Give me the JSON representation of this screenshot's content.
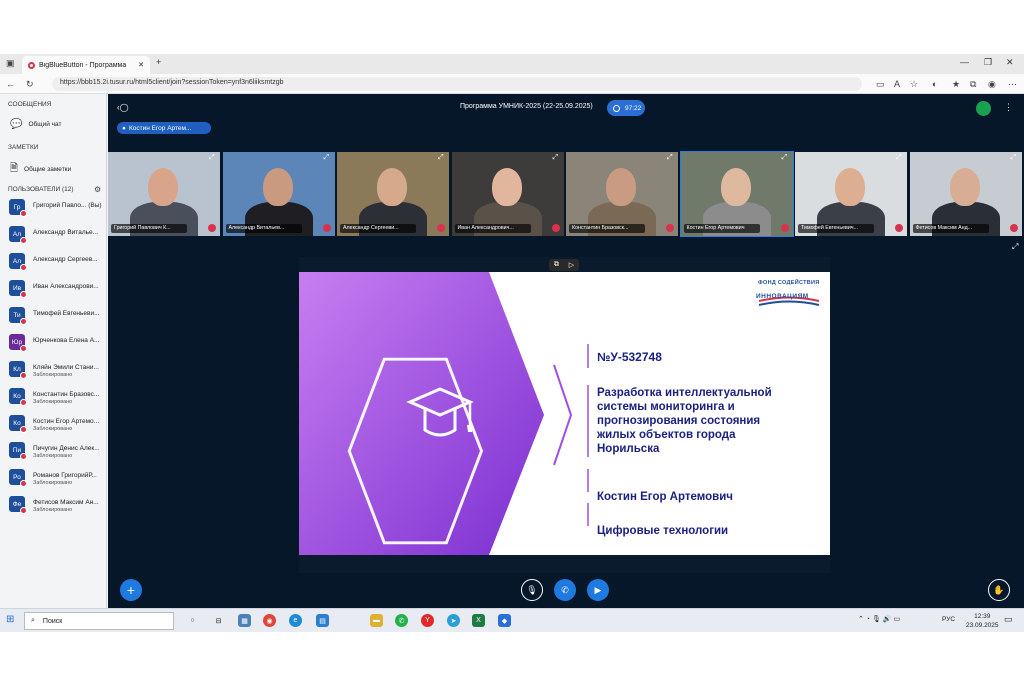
{
  "browser": {
    "tab_title": "BigBlueButton - Программа",
    "url": "https://bbb15.2i.tusur.ru/html5client/join?sessionToken=ynf3n6liiksmtzgb"
  },
  "sidebar": {
    "messages_title": "СООБЩЕНИЯ",
    "public_chat": "Общий чат",
    "notes_title": "ЗАМЕТКИ",
    "shared_notes": "Общие заметки",
    "users_title": "ПОЛЬЗОВАТЕЛИ (12)",
    "users": [
      {
        "initials": "Гр",
        "name": "Григорий Павло... (Вы)",
        "status": "",
        "color": "#1f4f9a"
      },
      {
        "initials": "Ал",
        "name": "Александр Виталье...",
        "status": "",
        "color": "#1f4f9a"
      },
      {
        "initials": "Ал",
        "name": "Александр Сергеев...",
        "status": "",
        "color": "#1f4f9a"
      },
      {
        "initials": "Ив",
        "name": "Иван Александрови...",
        "status": "",
        "color": "#1f4f9a"
      },
      {
        "initials": "Ти",
        "name": "Тимофей Евгеньеви...",
        "status": "",
        "color": "#1f4f9a"
      },
      {
        "initials": "Юр",
        "name": "Юрченкова Елена А...",
        "status": "",
        "color": "#6a2a9a"
      },
      {
        "initials": "Кл",
        "name": "Кляйн Эмили Стани...",
        "status": "Заблокировано",
        "color": "#1f4f9a"
      },
      {
        "initials": "Ко",
        "name": "Константин Бразовс...",
        "status": "Заблокировано",
        "color": "#1f4f9a"
      },
      {
        "initials": "Ко",
        "name": "Костин Егор Артемо...",
        "status": "Заблокировано",
        "color": "#1f4f9a"
      },
      {
        "initials": "Пи",
        "name": "Пичугин Денис Алек...",
        "status": "Заблокировано",
        "color": "#1f4f9a"
      },
      {
        "initials": "Ро",
        "name": "Романов ГригорийР...",
        "status": "Заблокировано",
        "color": "#1f4f9a"
      },
      {
        "initials": "Фе",
        "name": "Фетисов Максим Ан...",
        "status": "Заблокировано",
        "color": "#1f4f9a"
      }
    ]
  },
  "meeting": {
    "title": "Программа УМНИК-2025 (22-25.09.2025)",
    "timer": "97:22",
    "presenter": "Костин Егор Артем..."
  },
  "videos": [
    {
      "name": "Григорий Павлович К...",
      "bg": "#b9c3cf",
      "skin": "#d9a58a",
      "shirt": "#4a4f5c"
    },
    {
      "name": "Александр Витальев...",
      "bg": "#5d86b8",
      "skin": "#c99a80",
      "shirt": "#1f1f23"
    },
    {
      "name": "Александр Сергееви...",
      "bg": "#8b7a5a",
      "skin": "#d6a98c",
      "shirt": "#2d2f36"
    },
    {
      "name": "Иван Александрович...",
      "bg": "#3e3c3a",
      "skin": "#e0b79d",
      "shirt": "#5a5248"
    },
    {
      "name": "Константин Бразовск...",
      "bg": "#8a8479",
      "skin": "#c89b82",
      "shirt": "#7a6a55"
    },
    {
      "name": "Костин Егор Артемович",
      "bg": "#6f7a6a",
      "skin": "#dfb8a0",
      "shirt": "#8c8c8c"
    },
    {
      "name": "Тимофей Евгеньевич...",
      "bg": "#d9dde0",
      "skin": "#dcae92",
      "shirt": "#3a3f48"
    },
    {
      "name": "Фетисов Максим Анд...",
      "bg": "#c7ccd2",
      "skin": "#d7ad95",
      "shirt": "#2a2e36"
    }
  ],
  "slide": {
    "logo_line1": "ФОНД СОДЕЙСТВИЯ",
    "logo_line2": "ИННОВАЦИЯМ",
    "number": "№У-532748",
    "project_line1": "Разработка интеллектуальной",
    "project_line2": "системы мониторинга и",
    "project_line3": "прогнозирования состояния",
    "project_line4": "жилых объектов города",
    "project_line5": "Норильска",
    "author": "Костин Егор Артемович",
    "category": "Цифровые технологии",
    "accent": "#a24ee0"
  },
  "taskbar": {
    "search": "Поиск",
    "lang": "РУС",
    "time": "12:39",
    "date": "23.09.2025"
  }
}
